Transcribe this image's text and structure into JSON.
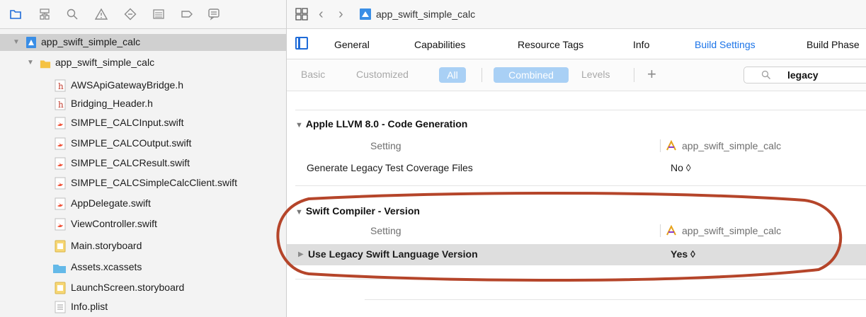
{
  "navigator": {
    "toolbar_icons": [
      "folder-icon",
      "hierarchy-icon",
      "search-icon",
      "warning-icon",
      "diamond-icon",
      "list-icon",
      "tag-icon",
      "comment-icon"
    ],
    "project": {
      "label": "app_swift_simple_calc"
    },
    "group": {
      "label": "app_swift_simple_calc"
    },
    "files": [
      {
        "label": "AWSApiGatewayBridge.h",
        "icon": "header-file-icon"
      },
      {
        "label": "Bridging_Header.h",
        "icon": "header-file-icon"
      },
      {
        "label": "SIMPLE_CALCInput.swift",
        "icon": "swift-file-icon"
      },
      {
        "label": "SIMPLE_CALCOutput.swift",
        "icon": "swift-file-icon"
      },
      {
        "label": "SIMPLE_CALCResult.swift",
        "icon": "swift-file-icon"
      },
      {
        "label": "SIMPLE_CALCSimpleCalcClient.swift",
        "icon": "swift-file-icon"
      },
      {
        "label": "AppDelegate.swift",
        "icon": "swift-file-icon"
      },
      {
        "label": "ViewController.swift",
        "icon": "swift-file-icon"
      },
      {
        "label": "Main.storyboard",
        "icon": "storyboard-icon"
      },
      {
        "label": "Assets.xcassets",
        "icon": "asset-folder-icon"
      },
      {
        "label": "LaunchScreen.storyboard",
        "icon": "storyboard-icon"
      },
      {
        "label": "Info.plist",
        "icon": "plist-icon"
      }
    ]
  },
  "jumpbar": {
    "crumb": "app_swift_simple_calc"
  },
  "tabs": [
    "General",
    "Capabilities",
    "Resource Tags",
    "Info",
    "Build Settings",
    "Build Phase"
  ],
  "active_tab": "Build Settings",
  "filters": {
    "basic": "Basic",
    "customized": "Customized",
    "all": "All",
    "combined": "Combined",
    "levels": "Levels",
    "add": "+",
    "search_value": "legacy"
  },
  "sections": [
    {
      "title": "Apple LLVM 8.0 - Code Generation",
      "setting_head": "Setting",
      "target_head": "app_swift_simple_calc",
      "rows": [
        {
          "name": "Generate Legacy Test Coverage Files",
          "value": "No ◊"
        }
      ]
    },
    {
      "title": "Swift Compiler - Version",
      "setting_head": "Setting",
      "target_head": "app_swift_simple_calc",
      "rows": [
        {
          "name": "Use Legacy Swift Language Version",
          "value": "Yes ◊"
        }
      ]
    }
  ],
  "colors": {
    "accent": "#1a73e8",
    "pill": "#a9d0f5",
    "annotation": "#b5452a",
    "folder": "#f5c242"
  }
}
